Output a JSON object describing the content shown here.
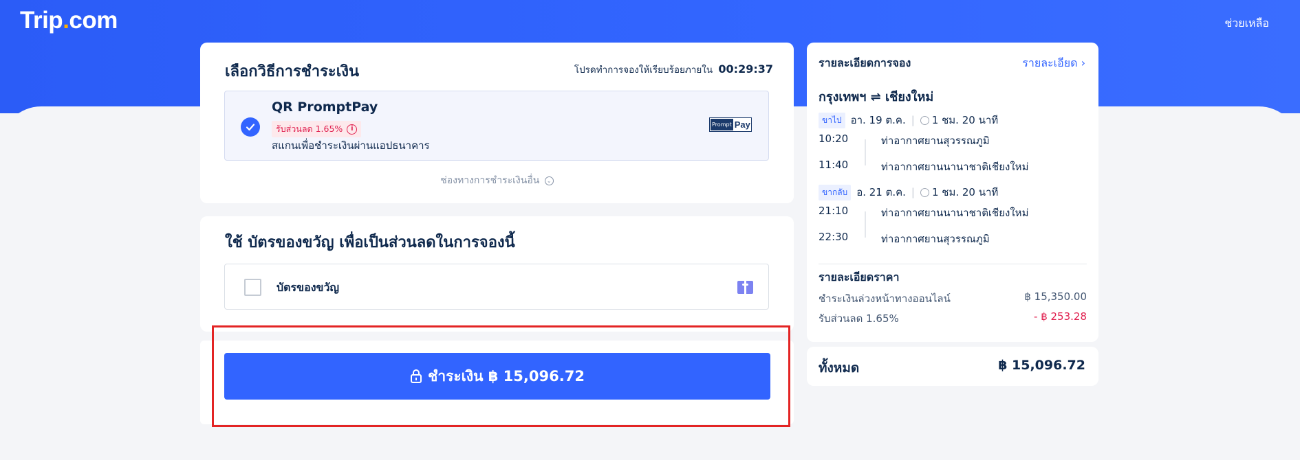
{
  "header": {
    "logo_text": "Trip",
    "logo_suffix": "com",
    "help_label": "ช่วยเหลือ"
  },
  "payment": {
    "title": "เลือกวิธีการชำระเงิน",
    "timer_label": "โปรดทำการจองให้เรียบร้อยภายใน",
    "timer_value": "00:29:37",
    "method_name": "QR PromptPay",
    "discount_badge": "รับส่วนลด 1.65%",
    "method_desc": "สแกนเพื่อชำระเงินผ่านแอปธนาคาร",
    "logo_left": "Prompt",
    "logo_right": "Pay",
    "other_methods_label": "ช่องทางการชำระเงินอื่น"
  },
  "gift": {
    "title": "ใช้ บัตรของขวัญ เพื่อเป็นส่วนลดในการจองนี้",
    "checkbox_label": "บัตรของขวัญ",
    "checked": false
  },
  "pay_button": {
    "label": "ชำระเงิน ฿ 15,096.72"
  },
  "summary": {
    "title": "รายละเอียดการจอง",
    "details_link": "รายละเอียด",
    "route": "กรุงเทพฯ ⇌ เชียงใหม่",
    "outbound": {
      "tag": "ขาไป",
      "date": "อา. 19 ต.ค.",
      "duration": "1 ชม. 20 นาที",
      "dep_time": "10:20",
      "dep_airport": "ท่าอากาศยานสุวรรณภูมิ",
      "arr_time": "11:40",
      "arr_airport": "ท่าอากาศยานนานาชาติเชียงใหม่"
    },
    "return": {
      "tag": "ขากลับ",
      "date": "อ. 21 ต.ค.",
      "duration": "1 ชม. 20 นาที",
      "dep_time": "21:10",
      "dep_airport": "ท่าอากาศยานนานาชาติเชียงใหม่",
      "arr_time": "22:30",
      "arr_airport": "ท่าอากาศยานสุวรรณภูมิ"
    },
    "price_title": "รายละเอียดราคา",
    "prepay_label": "ชำระเงินล่วงหน้าทางออนไลน์",
    "prepay_value": "฿ 15,350.00",
    "discount_label": "รับส่วนลด 1.65%",
    "discount_value": "- ฿ 253.28",
    "total_label": "ทั้งหมด",
    "total_value": "฿ 15,096.72"
  },
  "colors": {
    "brand_blue": "#3264ff",
    "discount_red": "#e0204f",
    "highlight_red": "#e32424"
  }
}
